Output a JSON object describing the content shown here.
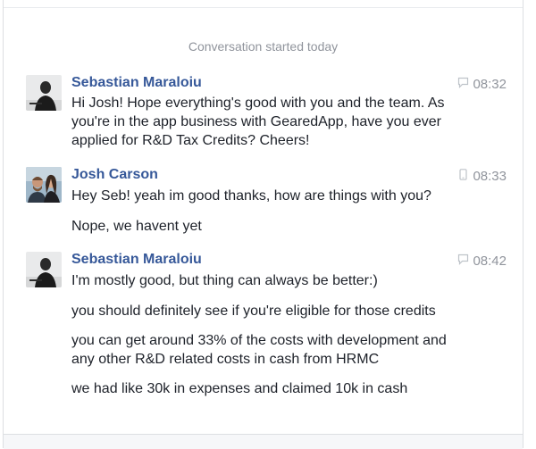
{
  "conversation": {
    "started_label": "Conversation started today",
    "groups": [
      {
        "sender": "Sebastian Maraloiu",
        "time": "08:32",
        "icon": "chat-bubble-icon",
        "messages": [
          "Hi Josh! Hope everything's good with you and the team. As you're in the app business with GearedApp, have you ever applied for R&D Tax Credits? Cheers!"
        ]
      },
      {
        "sender": "Josh Carson",
        "time": "08:33",
        "icon": "mobile-phone-icon",
        "messages": [
          "Hey Seb! yeah im good thanks, how are things with you?",
          "Nope, we havent yet"
        ]
      },
      {
        "sender": "Sebastian Maraloiu",
        "time": "08:42",
        "icon": "chat-bubble-icon",
        "messages": [
          "I'm mostly good, but thing can always be better:)",
          "you should definitely see if you're eligible for those credits",
          "you can get around 33% of the costs with development and any other R&D related costs in cash from HRMC",
          "we had like 30k in expenses and claimed 10k in cash"
        ]
      }
    ]
  },
  "colors": {
    "sender_name": "#365899",
    "meta_text": "#90949c",
    "message_text": "#1d2129"
  }
}
